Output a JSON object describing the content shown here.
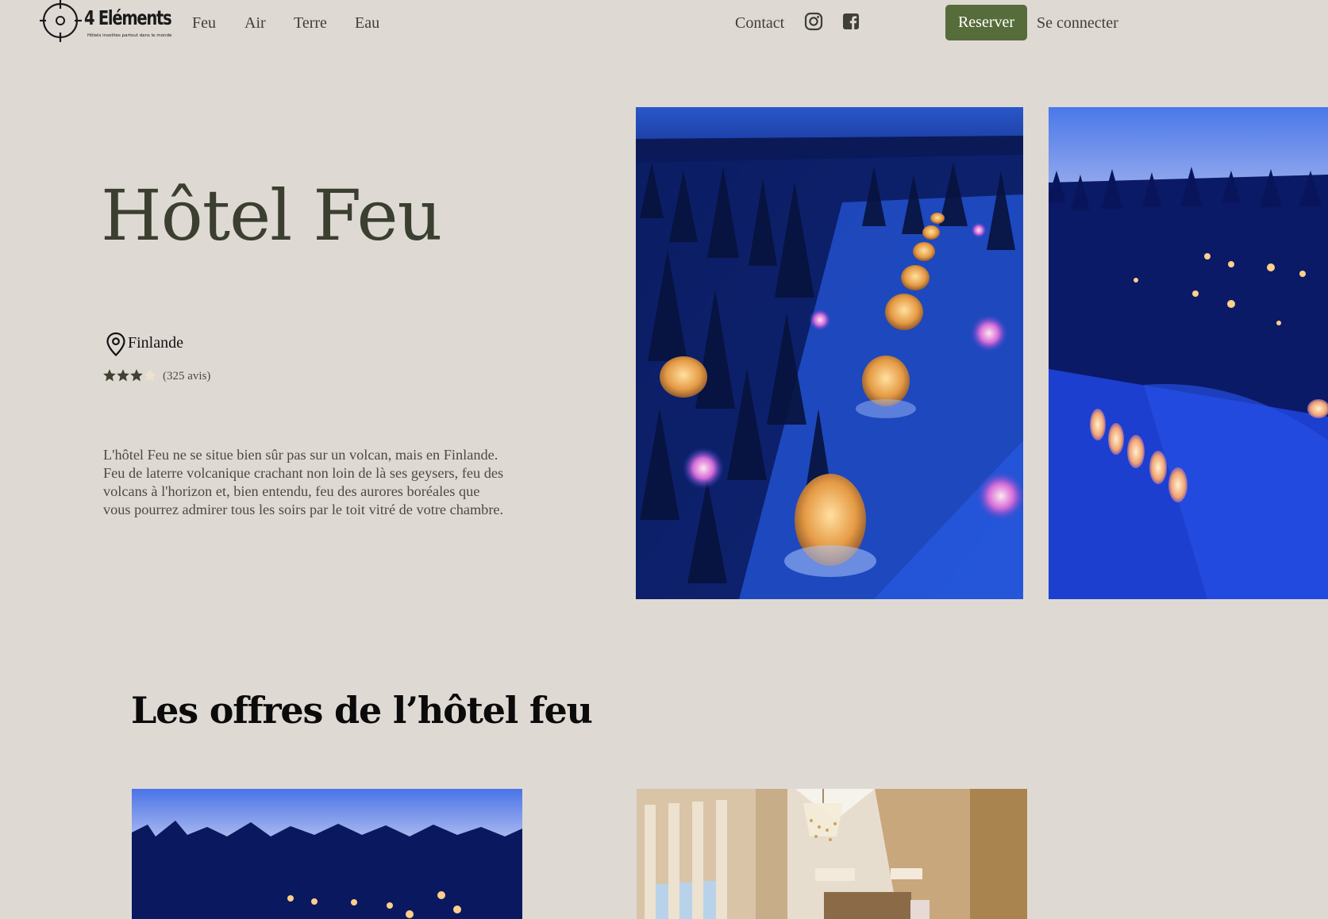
{
  "nav": {
    "logo": {
      "brand": "4 Eléments",
      "tagline": "Hôtels insolites partout dans le monde"
    },
    "links": [
      "Feu",
      "Air",
      "Terre",
      "Eau"
    ],
    "contact": "Contact",
    "social": [
      {
        "icon": "instagram-icon",
        "label": "Instagram"
      },
      {
        "icon": "facebook-icon",
        "label": "Facebook"
      }
    ],
    "reserve_label": "Reserver",
    "login_label": "Se connecter"
  },
  "hero": {
    "title": "Hôtel Feu",
    "location": "Finlande",
    "rating": {
      "stars": 3,
      "max": 5,
      "reviews": "(325 avis)"
    },
    "description": "L'hôtel Feu ne se situe bien sûr pas sur un volcan, mais en Finlande. Feu de laterre volcanique crachant non loin de là ses geysers, feu des volcans à l'horizon et, bien entendu, feu des aurores boréales que vous pourrez admirer tous les soirs par le toit vitré de votre chambre."
  },
  "offers": {
    "title": "Les offres de l’hôtel feu"
  },
  "colors": {
    "background": "#dfd9d4",
    "accent": "#566c3a",
    "title": "#3b3f30",
    "star_filled": "#3f4132",
    "star_empty": "#ece2cf"
  }
}
